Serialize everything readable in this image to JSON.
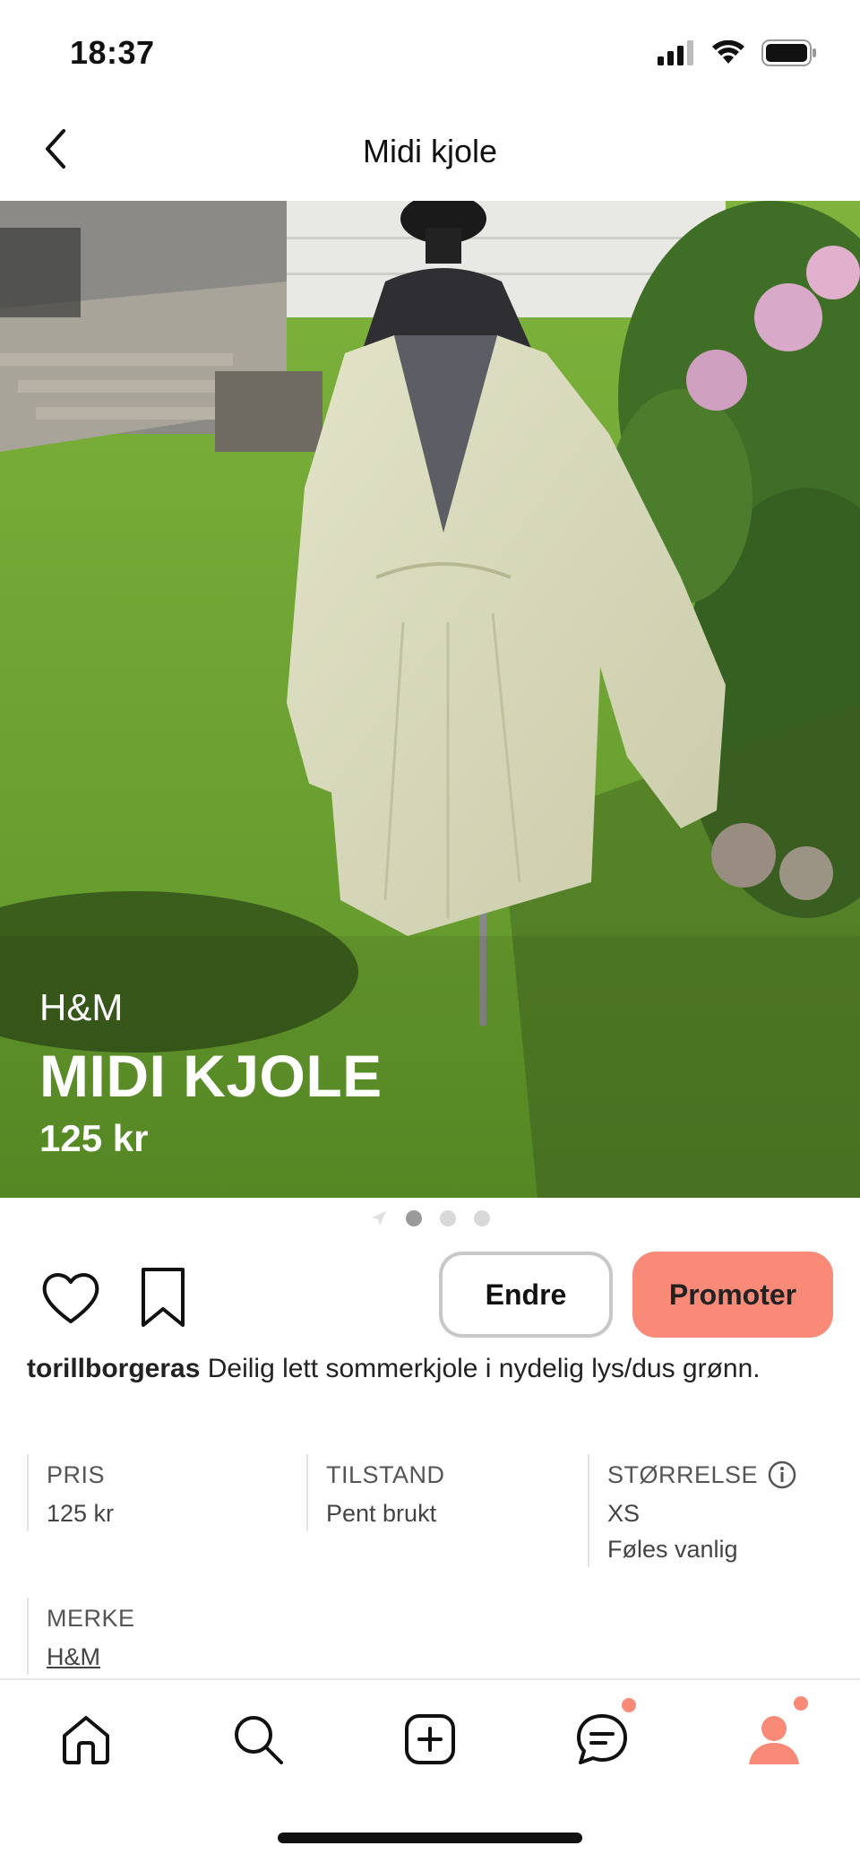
{
  "status_bar": {
    "time": "18:37"
  },
  "header": {
    "title": "Midi kjole"
  },
  "hero": {
    "brand": "H&M",
    "title": "MIDI KJOLE",
    "price": "125 kr",
    "image_count": 3,
    "active_index": 0
  },
  "actions": {
    "edit_label": "Endre",
    "promote_label": "Promoter"
  },
  "caption": {
    "username": "torillborgeras",
    "text": "Deilig lett sommerkjole i nydelig lys/dus grønn."
  },
  "details": {
    "price": {
      "label": "PRIS",
      "value": "125 kr"
    },
    "condition": {
      "label": "TILSTAND",
      "value": "Pent brukt"
    },
    "size": {
      "label": "STØRRELSE",
      "value": "XS",
      "fit": "Føles vanlig"
    },
    "brand": {
      "label": "MERKE",
      "value": "H&M"
    }
  },
  "tab_bar": {
    "items": [
      "home-icon",
      "search-icon",
      "add-icon",
      "chat-icon",
      "profile-icon"
    ],
    "badges": [
      "chat",
      "profile"
    ]
  },
  "colors": {
    "accent": "#fa8a78",
    "border": "#c8c8c8"
  }
}
